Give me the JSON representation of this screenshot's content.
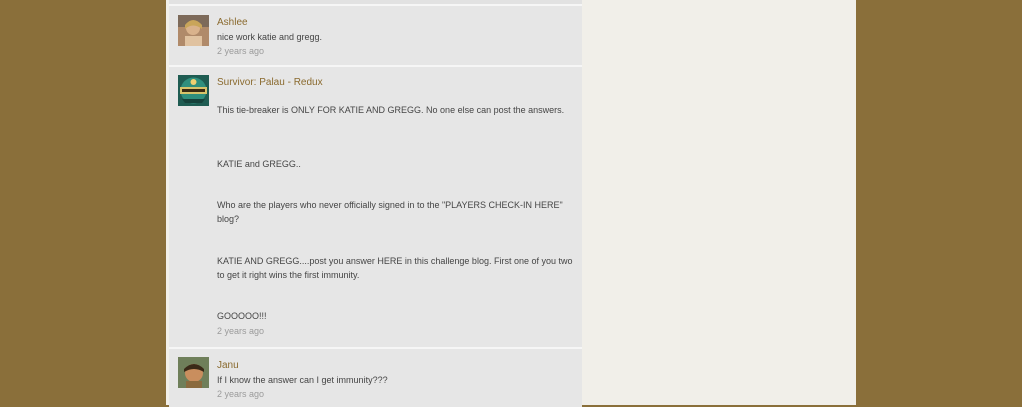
{
  "comments": [
    {
      "author": "Ashlee",
      "text": "nice work katie and gregg.",
      "timestamp": "2 years ago",
      "avatar_icon": "user-photo-icon"
    },
    {
      "author": "Survivor: Palau - Redux",
      "paragraphs": [
        "This tie-breaker is ONLY FOR KATIE AND GREGG.  No one else can post the answers.",
        "KATIE and GREGG..",
        "Who are the players who never officially signed in to the \"PLAYERS CHECK-IN HERE\" blog?",
        "KATIE AND GREGG....post you answer HERE in this challenge blog.  First one of you two to get it right wins the first immunity.",
        "GOOOOO!!!"
      ],
      "timestamp": "2 years ago",
      "avatar_icon": "survivor-logo-icon"
    },
    {
      "author": "Janu",
      "text": "If I know the answer can I get immunity???",
      "timestamp": "2 years ago",
      "avatar_icon": "user-photo-icon"
    }
  ],
  "colors": {
    "frame": "#8a6f3a",
    "page": "#f1efe9",
    "comment_bg": "#e6e6e6",
    "author_link": "#8a6a2e",
    "text": "#454545",
    "timestamp": "#9b9b9b"
  }
}
